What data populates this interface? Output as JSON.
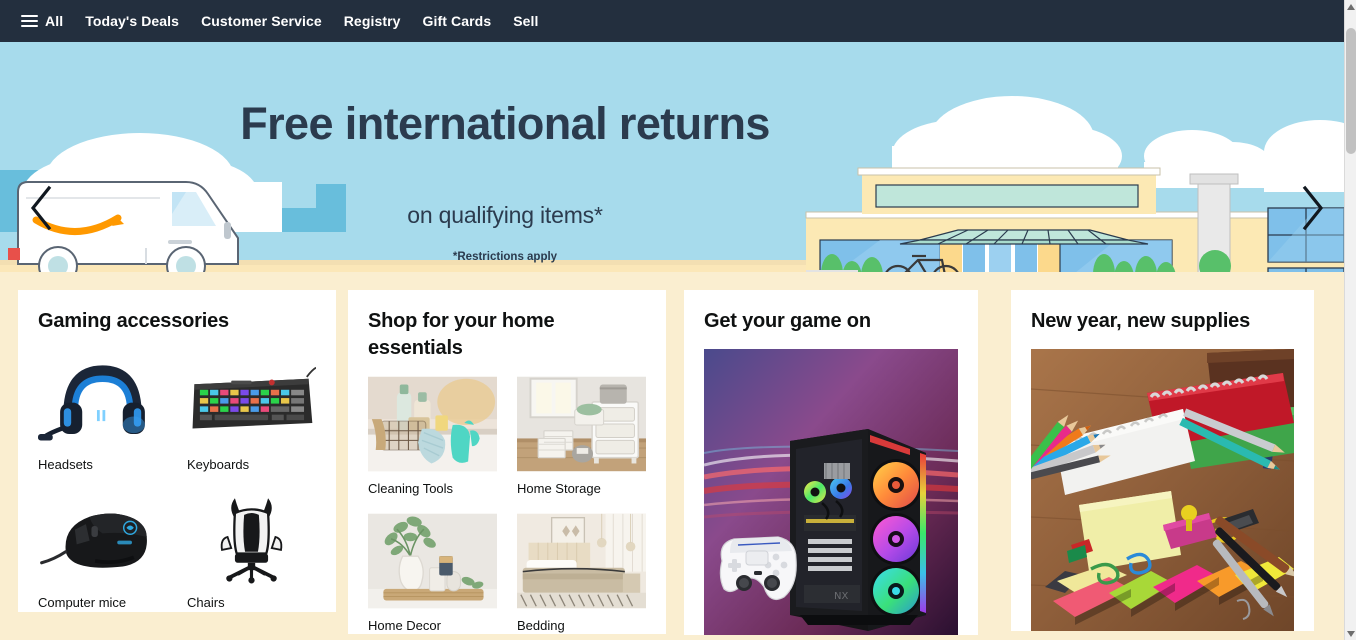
{
  "nav": {
    "menu_icon": "hamburger-menu-icon",
    "all_label": "All",
    "items": [
      {
        "label": "Today's Deals"
      },
      {
        "label": "Customer Service"
      },
      {
        "label": "Registry"
      },
      {
        "label": "Gift Cards"
      },
      {
        "label": "Sell"
      }
    ]
  },
  "hero": {
    "title": "Free international returns",
    "subtitle": "on qualifying items*",
    "fineprint": "*Restrictions apply",
    "prev_icon": "chevron-left-icon",
    "next_icon": "chevron-right-icon",
    "background_color": "#A7DBEC",
    "text_color": "#2B3B4E"
  },
  "deck": {
    "background_color": "#FAEED0",
    "cards": [
      {
        "title": "Gaming accessories",
        "layout": "grid-4",
        "tiles": [
          {
            "label": "Headsets",
            "image": "gaming-headset-photo"
          },
          {
            "label": "Keyboards",
            "image": "gaming-keyboard-photo"
          },
          {
            "label": "Computer mice",
            "image": "gaming-mouse-photo"
          },
          {
            "label": "Chairs",
            "image": "gaming-chair-photo"
          }
        ]
      },
      {
        "title": "Shop for your home essentials",
        "layout": "grid-4",
        "tiles": [
          {
            "label": "Cleaning Tools",
            "image": "cleaning-supplies-photo"
          },
          {
            "label": "Home Storage",
            "image": "storage-cabinet-photo"
          },
          {
            "label": "Home Decor",
            "image": "vase-decor-photo"
          },
          {
            "label": "Bedding",
            "image": "bedroom-bedding-photo"
          }
        ]
      },
      {
        "title": "Get your game on",
        "layout": "single",
        "tiles": [
          {
            "label": "",
            "image": "rgb-gaming-pc-and-controller-photo"
          }
        ]
      },
      {
        "title": "New year, new supplies",
        "layout": "single",
        "tiles": [
          {
            "label": "",
            "image": "school-office-supplies-photo"
          }
        ]
      }
    ]
  },
  "scrollbar": {
    "up_icon": "scroll-up-arrow-icon",
    "down_icon": "scroll-down-arrow-icon",
    "thumb": "scrollbar-thumb"
  }
}
